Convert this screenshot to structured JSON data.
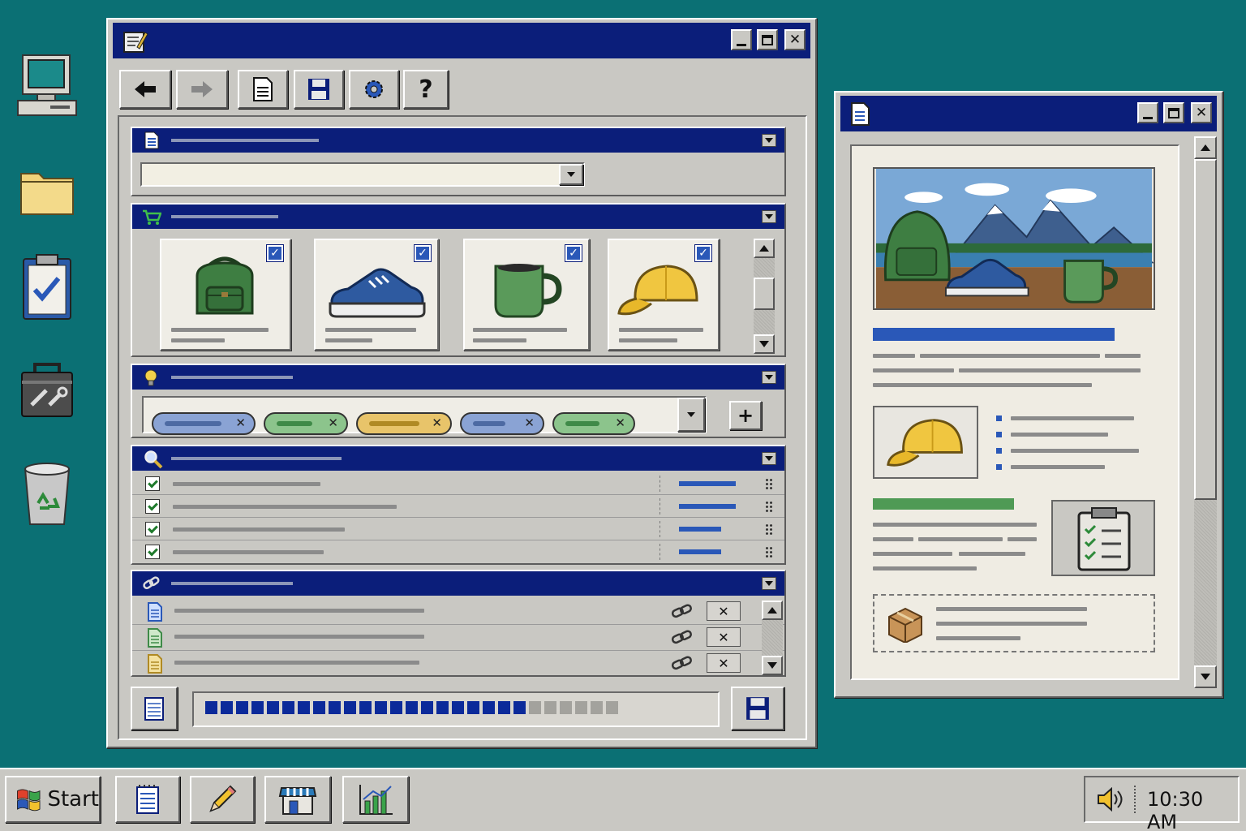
{
  "desktop": {
    "icons": [
      "computer-icon",
      "folder-icon",
      "clipboard-checklist-icon",
      "toolbox-icon",
      "recycle-bin-icon"
    ]
  },
  "main_window": {
    "toolbar": [
      "back-arrow-icon",
      "forward-arrow-icon",
      "document-icon",
      "save-icon",
      "gear-icon",
      "help-icon"
    ],
    "help_label": "?",
    "sections": {
      "document": {
        "icon": "document-icon",
        "select_value": ""
      },
      "cart": {
        "icon": "cart-icon",
        "products": [
          {
            "name": "backpack-icon",
            "checked": true
          },
          {
            "name": "sneaker-icon",
            "checked": true
          },
          {
            "name": "mug-icon",
            "checked": true
          },
          {
            "name": "cap-icon",
            "checked": true
          }
        ]
      },
      "tags": {
        "icon": "lightbulb-icon",
        "items": [
          {
            "color": "#8aa3d4",
            "bar": "#4d6aa3"
          },
          {
            "color": "#8cc48c",
            "bar": "#3f8a48"
          },
          {
            "color": "#e8c46a",
            "bar": "#b08a24"
          },
          {
            "color": "#8aa3d4",
            "bar": "#4d6aa3"
          },
          {
            "color": "#8cc48c",
            "bar": "#3f8a48"
          }
        ],
        "remove_glyph": "✕",
        "add_glyph": "+"
      },
      "search": {
        "icon": "magnifier-icon",
        "rows": [
          {
            "checked": true,
            "value": 0.95
          },
          {
            "checked": true,
            "value": 0.95
          },
          {
            "checked": true,
            "value": 0.7
          },
          {
            "checked": true,
            "value": 0.7
          }
        ]
      },
      "links": {
        "icon": "link-icon",
        "rows": [
          {
            "file_icon": "blue-document-icon",
            "color": "#2a58b8"
          },
          {
            "file_icon": "green-document-icon",
            "color": "#3f8a48"
          },
          {
            "file_icon": "yellow-document-icon",
            "color": "#d9b23a"
          }
        ],
        "remove_glyph": "✕"
      }
    },
    "footer": {
      "progress": 0.72,
      "segments_total": 27,
      "segments_filled": 21
    }
  },
  "preview_window": {
    "title_icon": "document-icon",
    "hero_image": "backpack-sneaker-mug-mountain-scene",
    "thumb": "cap-icon",
    "clipboard": "clipboard-checklist-icon",
    "package": "package-icon",
    "accent_blue": "#2a58b8",
    "accent_green": "#4f9a55"
  },
  "taskbar": {
    "start_label": "Start",
    "buttons": [
      "notepad-icon",
      "pencil-icon",
      "store-icon",
      "chart-icon"
    ],
    "clock": "10:30 AM"
  }
}
